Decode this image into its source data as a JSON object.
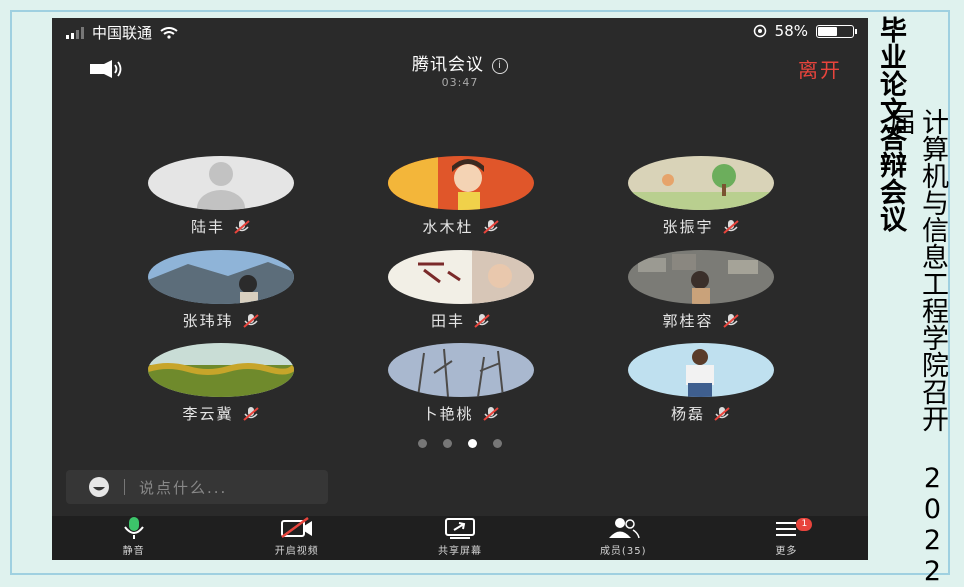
{
  "statusbar": {
    "carrier": "中国联通",
    "battery_text": "58%",
    "battery_level": 0.58
  },
  "header": {
    "title": "腾讯会议",
    "timer": "03:47",
    "leave_label": "离开"
  },
  "participants": [
    {
      "name": "陆丰",
      "avatar": "default-silhouette",
      "muted": true
    },
    {
      "name": "水木杜",
      "avatar": "cartoon-portrait",
      "muted": true
    },
    {
      "name": "张振宇",
      "avatar": "drawing-tree",
      "muted": true
    },
    {
      "name": "张玮玮",
      "avatar": "mountain-sky",
      "muted": true
    },
    {
      "name": "田丰",
      "avatar": "calligraphy-card",
      "muted": true
    },
    {
      "name": "郭桂容",
      "avatar": "stone-wall",
      "muted": true
    },
    {
      "name": "李云冀",
      "avatar": "sunflower-field",
      "muted": true
    },
    {
      "name": "卜艳桃",
      "avatar": "bare-trees",
      "muted": true
    },
    {
      "name": "杨磊",
      "avatar": "person-photo",
      "muted": true
    }
  ],
  "pager": {
    "count": 4,
    "active_index": 2
  },
  "chat": {
    "placeholder": "说点什么..."
  },
  "toolbar": {
    "mute_label": "静音",
    "video_label": "开启视频",
    "share_label": "共享屏幕",
    "members_label": "成员(35)",
    "more_label": "更多",
    "more_badge": "1"
  },
  "side": {
    "title_1": "毕业论文答辩会议",
    "title_2": "计算机与信息工程学院召开 2022 届"
  },
  "colors": {
    "accent_red": "#e8443c",
    "mic_green": "#3cc46a",
    "background": "#2a2a2a"
  }
}
